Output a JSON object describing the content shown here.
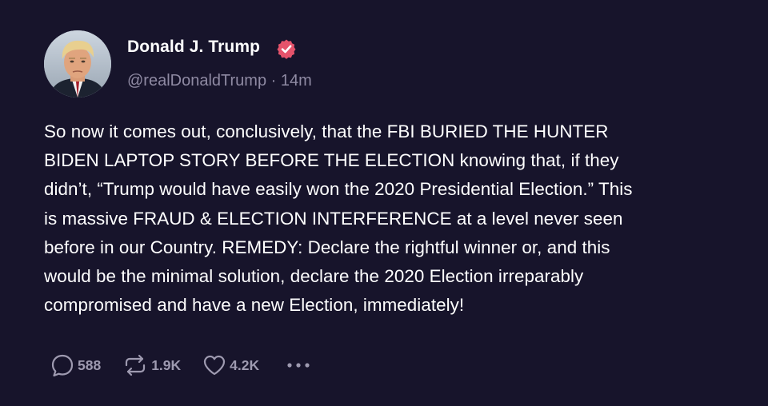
{
  "author": {
    "display_name": "Donald J. Trump",
    "handle": "@realDonaldTrump",
    "separator": "·",
    "time_ago": "14m",
    "verified_icon": "verified-badge-icon",
    "avatar_icon": "profile-avatar"
  },
  "post": {
    "text": "So now it comes out, conclusively, that the FBI BURIED THE HUNTER\nBIDEN LAPTOP STORY BEFORE THE ELECTION knowing that, if they\ndidn’t, “Trump would have easily won the 2020 Presidential Election.” This\nis massive FRAUD & ELECTION INTERFERENCE at a  level never seen\nbefore in our Country. REMEDY: Declare the rightful winner or, and this\nwould be the minimal solution, declare the 2020 Election irreparably\ncompromised and have a new Election, immediately!"
  },
  "actions": {
    "reply": {
      "icon": "reply-icon",
      "count": "588"
    },
    "repost": {
      "icon": "repost-icon",
      "count": "1.9K"
    },
    "like": {
      "icon": "heart-icon",
      "count": "4.2K"
    },
    "more": {
      "icon": "more-options-icon"
    }
  },
  "colors": {
    "background": "#17142b",
    "text": "#ffffff",
    "muted": "#8f8aa3",
    "verified": "#e5536b"
  }
}
